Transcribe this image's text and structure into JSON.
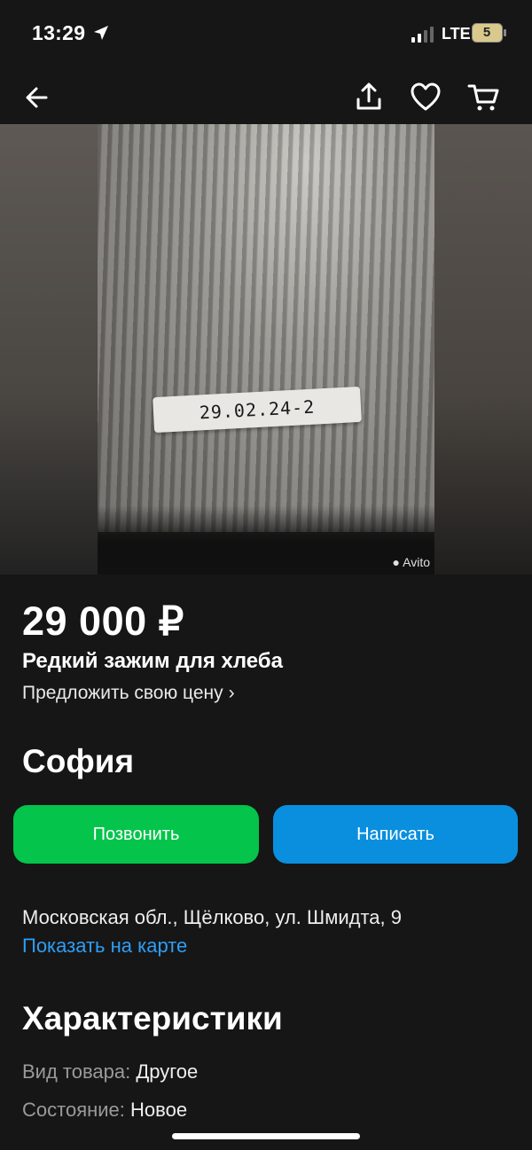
{
  "status": {
    "time": "13:29",
    "network": "LTE",
    "battery": "5"
  },
  "nav": {
    "back_icon": "arrow-left-icon",
    "share_icon": "share-icon",
    "favorite_icon": "heart-icon",
    "cart_icon": "cart-icon"
  },
  "photo": {
    "label_text": "29.02.24-2",
    "watermark": "Avito"
  },
  "listing": {
    "price": "29 000 ₽",
    "title": "Редкий зажим для хлеба",
    "offer_link": "Предложить свою цену",
    "seller": "София"
  },
  "actions": {
    "call_label": "Позвонить",
    "write_label": "Написать"
  },
  "location": {
    "address": "Московская обл., Щёлково, ул. Шмидта, 9",
    "map_link": "Показать на карте"
  },
  "characteristics": {
    "title": "Характеристики",
    "items": [
      {
        "key": "Вид товара:",
        "value": "Другое"
      },
      {
        "key": "Состояние:",
        "value": "Новое"
      }
    ]
  },
  "colors": {
    "background": "#161616",
    "call_green": "#04c44b",
    "write_blue": "#0a8fdf",
    "link_blue": "#2f9ef5"
  }
}
